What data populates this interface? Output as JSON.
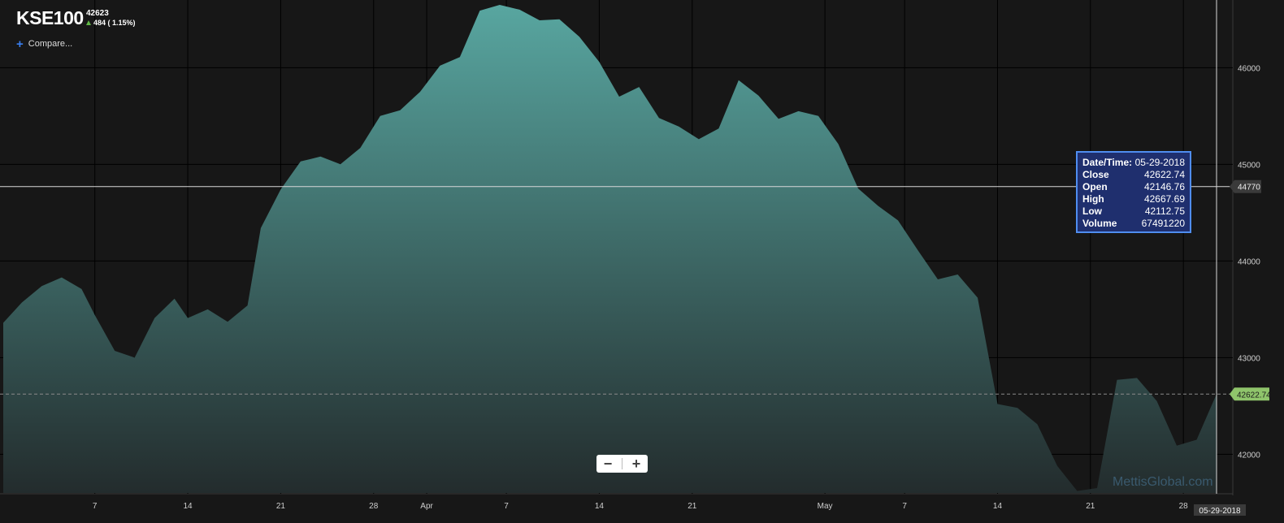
{
  "header": {
    "symbol": "KSE100",
    "last_price": "42623",
    "change": "484 ( 1.15%)",
    "compare_label": "Compare..."
  },
  "tooltip": {
    "rows": [
      {
        "key": "Date/Time:",
        "value": "05-29-2018"
      },
      {
        "key": "Close",
        "value": "42622.74"
      },
      {
        "key": "Open",
        "value": "42146.76"
      },
      {
        "key": "High",
        "value": "42667.69"
      },
      {
        "key": "Low",
        "value": "42112.75"
      },
      {
        "key": "Volume",
        "value": "67491220"
      }
    ]
  },
  "crosshair": {
    "price_label": "44770",
    "date_label": "05-29-2018"
  },
  "last_value_label": "42622.74",
  "zoom": {
    "minus_icon": "minus-icon",
    "plus_icon": "plus-icon"
  },
  "watermark": "MettisGlobal.com",
  "colors": {
    "background": "#171717",
    "area_top": "#58a6a0",
    "area_bottom": "#232c2d",
    "last_value_tag": "#8fc46b",
    "tooltip_bg": "#1f2f6e",
    "tooltip_border": "#4f8df0",
    "up": "#5fb845"
  },
  "chart_data": {
    "type": "area",
    "y_ticks": [
      42000,
      43000,
      44000,
      45000,
      46000
    ],
    "x_ticks": [
      {
        "day": 7,
        "label": "7"
      },
      {
        "day": 14,
        "label": "14"
      },
      {
        "day": 21,
        "label": "21"
      },
      {
        "day": 28,
        "label": "28"
      },
      {
        "day": 32,
        "label": "Apr"
      },
      {
        "day": 38,
        "label": "7"
      },
      {
        "day": 45,
        "label": "14"
      },
      {
        "day": 52,
        "label": "21"
      },
      {
        "day": 62,
        "label": "May"
      },
      {
        "day": 68,
        "label": "7"
      },
      {
        "day": 75,
        "label": "14"
      },
      {
        "day": 82,
        "label": "21"
      },
      {
        "day": 89,
        "label": "28"
      }
    ],
    "ylim": [
      41600,
      46700
    ],
    "xlim": [
      0.1,
      91.5
    ],
    "points": [
      [
        0.1,
        43360
      ],
      [
        1.5,
        43570
      ],
      [
        3,
        43740
      ],
      [
        4.5,
        43830
      ],
      [
        6,
        43710
      ],
      [
        7,
        43440
      ],
      [
        8.5,
        43070
      ],
      [
        10,
        43000
      ],
      [
        11.5,
        43410
      ],
      [
        13,
        43610
      ],
      [
        14,
        43410
      ],
      [
        15.5,
        43500
      ],
      [
        17,
        43370
      ],
      [
        18.5,
        43540
      ],
      [
        19.5,
        44340
      ],
      [
        21,
        44740
      ],
      [
        22.5,
        45030
      ],
      [
        24,
        45080
      ],
      [
        25.5,
        45000
      ],
      [
        27,
        45170
      ],
      [
        28.5,
        45500
      ],
      [
        30,
        45560
      ],
      [
        31.5,
        45750
      ],
      [
        33,
        46020
      ],
      [
        34.5,
        46110
      ],
      [
        36,
        46590
      ],
      [
        37.5,
        46650
      ],
      [
        39,
        46600
      ],
      [
        40.5,
        46490
      ],
      [
        42,
        46500
      ],
      [
        43.5,
        46320
      ],
      [
        45,
        46060
      ],
      [
        46.5,
        45700
      ],
      [
        48,
        45800
      ],
      [
        49.5,
        45480
      ],
      [
        51,
        45390
      ],
      [
        52.5,
        45260
      ],
      [
        54,
        45370
      ],
      [
        55.5,
        45870
      ],
      [
        57,
        45710
      ],
      [
        58.5,
        45470
      ],
      [
        60,
        45550
      ],
      [
        61.5,
        45500
      ],
      [
        63,
        45210
      ],
      [
        64.5,
        44750
      ],
      [
        66,
        44570
      ],
      [
        67.5,
        44420
      ],
      [
        69,
        44110
      ],
      [
        70.5,
        43810
      ],
      [
        72,
        43860
      ],
      [
        73.5,
        43620
      ],
      [
        75,
        42520
      ],
      [
        76.5,
        42480
      ],
      [
        78,
        42310
      ],
      [
        79.5,
        41880
      ],
      [
        81,
        41620
      ],
      [
        82.5,
        41650
      ],
      [
        84,
        42770
      ],
      [
        85.5,
        42790
      ],
      [
        87,
        42550
      ],
      [
        88.5,
        42090
      ],
      [
        90,
        42150
      ],
      [
        91.5,
        42623
      ]
    ],
    "last_close": 42622.74,
    "crosshair_value": 44770,
    "crosshair_day": 91.5
  }
}
